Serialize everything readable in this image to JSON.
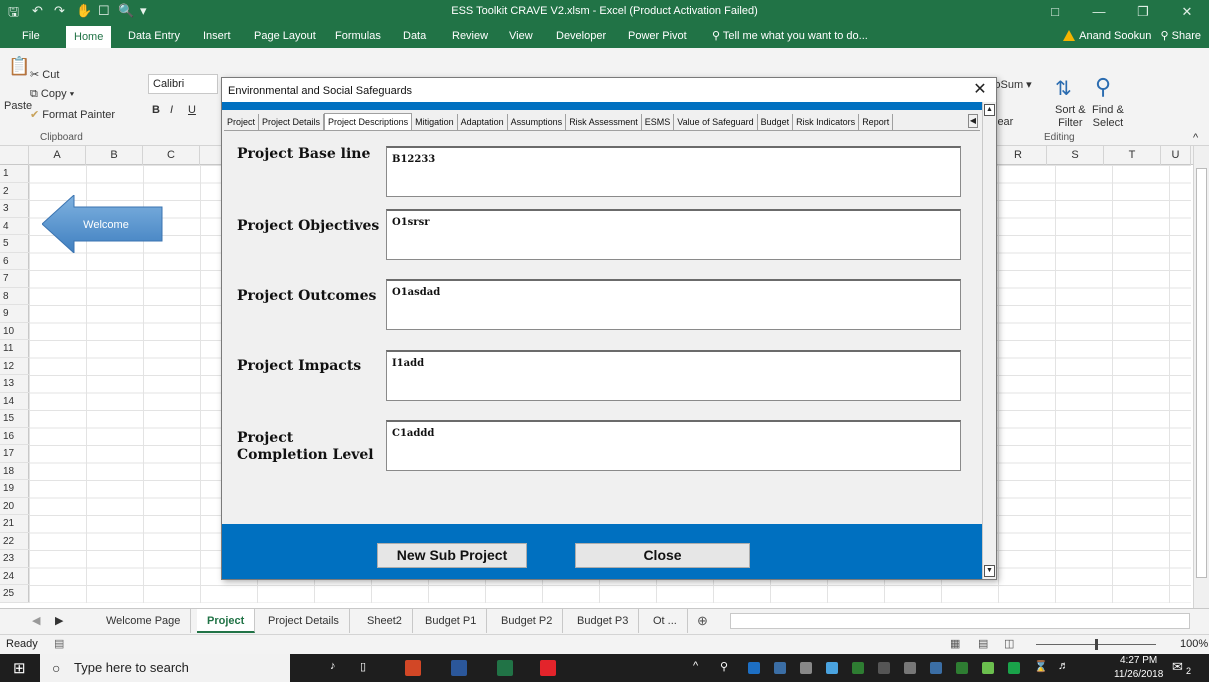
{
  "titlebar": {
    "title": "ESS Toolkit CRAVE V2.xlsm - Excel (Product Activation Failed)"
  },
  "ribbon_tabs": [
    "File",
    "Home",
    "Data Entry",
    "Insert",
    "Page Layout",
    "Formulas",
    "Data",
    "Review",
    "View",
    "Developer",
    "Power Pivot"
  ],
  "tell_me": "Tell me what you want to do...",
  "user": "Anand Sookun",
  "share": "Share",
  "ribbon": {
    "paste": "Paste",
    "cut": "Cut",
    "copy": "Copy",
    "format_painter": "Format Painter",
    "clipboard": "Clipboard",
    "font_name": "Calibri",
    "autosum": "AutoSum",
    "clear_partial": "lear",
    "sort_filter": "Sort &\nFilter",
    "find_select": "Find &\nSelect",
    "editing": "Editing"
  },
  "columns_left": [
    "A",
    "B",
    "C"
  ],
  "columns_right": [
    "R",
    "S",
    "T",
    "U"
  ],
  "rows": [
    "1",
    "2",
    "3",
    "4",
    "5",
    "6",
    "7",
    "8",
    "9",
    "10",
    "11",
    "12",
    "13",
    "14",
    "15",
    "16",
    "17",
    "18",
    "19",
    "20",
    "21",
    "22",
    "23",
    "24",
    "25"
  ],
  "welcome_arrow_label": "Welcome",
  "sheet_tabs": [
    "Welcome Page",
    "Project",
    "Project Details",
    "Sheet2",
    "Budget P1",
    "Budget P2",
    "Budget P3",
    "Ot ..."
  ],
  "active_sheet": "Project",
  "status": {
    "ready": "Ready",
    "zoom": "100%"
  },
  "taskbar": {
    "search_placeholder": "Type here to search",
    "time": "4:27 PM",
    "date": "11/26/2018",
    "notifications": "2"
  },
  "dialog": {
    "title": "Environmental and Social Safeguards",
    "tabs": [
      "Project",
      "Project Details",
      "Project Descriptions",
      "Mitigation",
      "Adaptation",
      "Assumptions",
      "Risk Assessment",
      "ESMS",
      "Value of Safeguard",
      "Budget",
      "Risk Indicators",
      "Report"
    ],
    "active_tab": "Project Descriptions",
    "fields": [
      {
        "label": "Project Base line",
        "value": "B12233"
      },
      {
        "label": "Project Objectives",
        "value": "O1srsr"
      },
      {
        "label": "Project Outcomes",
        "value": "O1asdad"
      },
      {
        "label": "Project Impacts",
        "value": "I1add"
      },
      {
        "label": "Project Completion Level",
        "value": "C1addd"
      }
    ],
    "buttons": {
      "new_sub_project": "New Sub Project",
      "close": "Close"
    }
  },
  "colors": {
    "excel_green": "#217346",
    "dialog_blue": "#0070c0",
    "arrow_blue": "#5b9bd5"
  }
}
